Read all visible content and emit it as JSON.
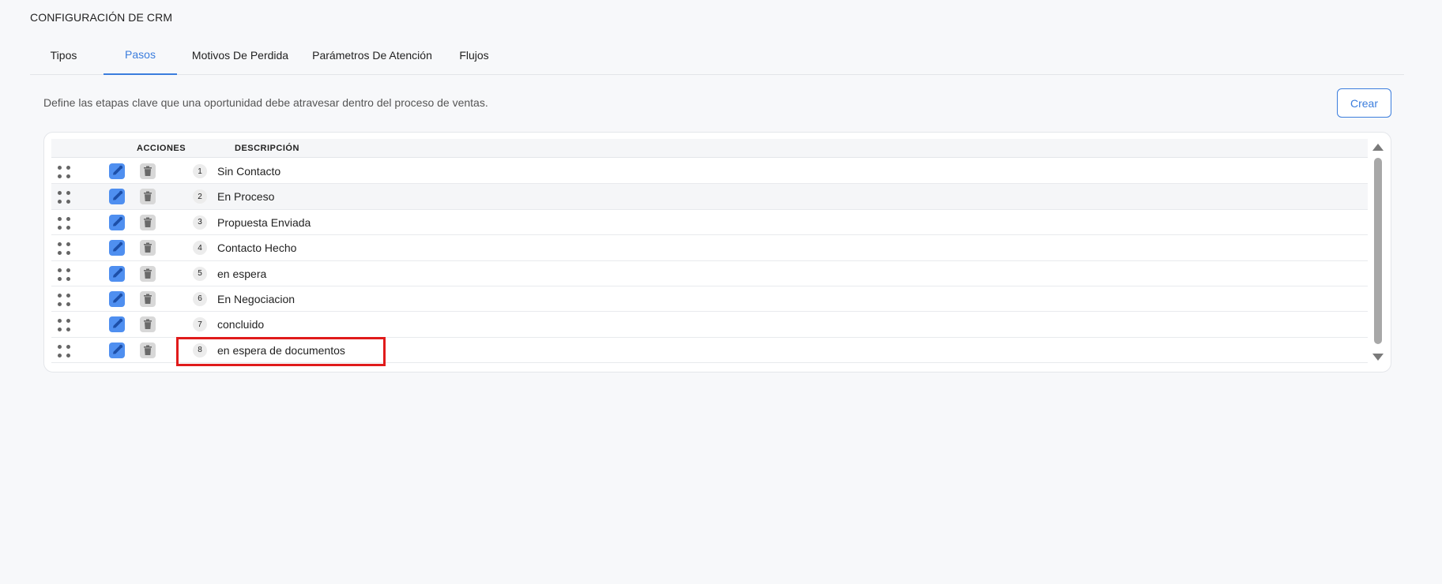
{
  "page": {
    "title": "CONFIGURACIÓN DE CRM"
  },
  "tabs": [
    {
      "label": "Tipos",
      "active": false
    },
    {
      "label": "Pasos",
      "active": true
    },
    {
      "label": "Motivos De Perdida",
      "active": false
    },
    {
      "label": "Parámetros De Atención",
      "active": false
    },
    {
      "label": "Flujos",
      "active": false
    }
  ],
  "section": {
    "description": "Define las etapas clave que una oportunidad debe atravesar dentro del proceso de ventas.",
    "create_label": "Crear"
  },
  "table": {
    "columns": {
      "actions": "ACCIONES",
      "description": "DESCRIPCIÓN"
    },
    "rows": [
      {
        "order": "1",
        "label": "Sin Contacto"
      },
      {
        "order": "2",
        "label": "En Proceso"
      },
      {
        "order": "3",
        "label": "Propuesta Enviada"
      },
      {
        "order": "4",
        "label": "Contacto Hecho"
      },
      {
        "order": "5",
        "label": "en espera"
      },
      {
        "order": "6",
        "label": "En Negociacion"
      },
      {
        "order": "7",
        "label": "concluido"
      },
      {
        "order": "8",
        "label": "en espera de documentos"
      }
    ]
  },
  "colors": {
    "accent": "#3b7ddd",
    "edit_button": "#4f8ff0",
    "highlight": "#e01b1b"
  },
  "icons": {
    "drag": "drag-handle-icon",
    "edit": "pencil-icon",
    "delete": "trash-icon"
  }
}
